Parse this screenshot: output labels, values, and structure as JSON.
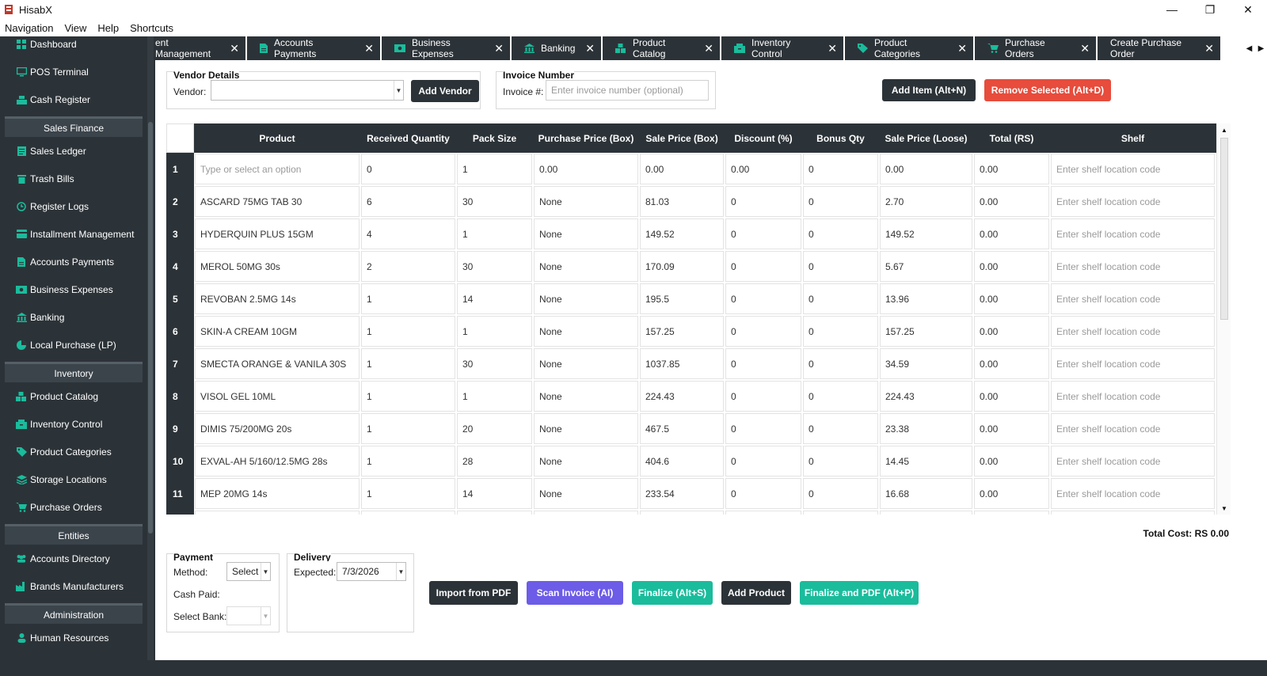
{
  "window": {
    "title": "HisabX",
    "controls": {
      "minimize": "—",
      "restore": "❐",
      "close": "✕"
    }
  },
  "menu": [
    "Navigation",
    "View",
    "Help",
    "Shortcuts"
  ],
  "sidebar": {
    "items_top": [
      {
        "label": "Dashboard",
        "icon": "dashboard-icon"
      },
      {
        "label": "POS Terminal",
        "icon": "monitor-icon"
      },
      {
        "label": "Cash Register",
        "icon": "register-icon"
      }
    ],
    "sections": [
      {
        "title": "Sales  Finance",
        "items": [
          {
            "label": "Sales Ledger",
            "icon": "ledger-icon"
          },
          {
            "label": "Trash Bills",
            "icon": "trash-icon"
          },
          {
            "label": "Register Logs",
            "icon": "history-icon"
          },
          {
            "label": "Installment Management",
            "icon": "card-icon"
          },
          {
            "label": "Accounts  Payments",
            "icon": "invoice-icon"
          },
          {
            "label": "Business Expenses",
            "icon": "money-icon"
          },
          {
            "label": "Banking",
            "icon": "bank-icon"
          },
          {
            "label": "Local Purchase (LP)",
            "icon": "pie-icon"
          }
        ]
      },
      {
        "title": "Inventory",
        "items": [
          {
            "label": "Product Catalog",
            "icon": "boxes-icon"
          },
          {
            "label": "Inventory Control",
            "icon": "inventory-icon"
          },
          {
            "label": "Product Categories",
            "icon": "tags-icon"
          },
          {
            "label": "Storage Locations",
            "icon": "layers-icon"
          },
          {
            "label": "Purchase Orders",
            "icon": "cart-icon"
          }
        ]
      },
      {
        "title": "Entities",
        "items": [
          {
            "label": "Accounts Directory",
            "icon": "users-icon"
          },
          {
            "label": "Brands  Manufacturers",
            "icon": "factory-icon"
          }
        ]
      },
      {
        "title": "Administration",
        "items": [
          {
            "label": "Human Resources",
            "icon": "user-icon"
          }
        ]
      }
    ]
  },
  "tabs": [
    {
      "label": "ent Management",
      "icon": "",
      "width": 114
    },
    {
      "label": "Accounts  Payments",
      "icon": "invoice-icon"
    },
    {
      "label": "Business Expenses",
      "icon": "money-icon"
    },
    {
      "label": "Banking",
      "icon": "bank-icon"
    },
    {
      "label": "Product Catalog",
      "icon": "boxes-icon"
    },
    {
      "label": "Inventory Control",
      "icon": "inventory-icon"
    },
    {
      "label": "Product Categories",
      "icon": "tags-icon"
    },
    {
      "label": "Purchase Orders",
      "icon": "cart-icon"
    },
    {
      "label": "Create Purchase Order",
      "icon": ""
    }
  ],
  "vendor": {
    "group_title": "Vendor Details",
    "label": "Vendor:",
    "value": "",
    "add_button": "Add Vendor"
  },
  "invoice": {
    "group_title": "Invoice Number",
    "label": "Invoice #:",
    "placeholder": "Enter invoice number (optional)"
  },
  "actions": {
    "add_item": "Add Item (Alt+N)",
    "remove_selected": "Remove Selected (Alt+D)"
  },
  "table": {
    "columns": [
      "Product",
      "Received Quantity",
      "Pack Size",
      "Purchase Price (Box)",
      "Sale Price (Box)",
      "Discount (%)",
      "Bonus Qty",
      "Sale Price (Loose)",
      "Total (RS)",
      "Shelf"
    ],
    "product_placeholder": "Type or select an option",
    "shelf_placeholder": "Enter shelf location code",
    "rows": [
      [
        "1",
        "",
        "0",
        "1",
        "0.00",
        "0.00",
        "0.00",
        "0",
        "0.00",
        "0.00",
        ""
      ],
      [
        "2",
        "ASCARD 75MG TAB 30",
        "6",
        "30",
        "None",
        "81.03",
        "0",
        "0",
        "2.70",
        "0.00",
        ""
      ],
      [
        "3",
        "HYDERQUIN PLUS 15GM",
        "4",
        "1",
        "None",
        "149.52",
        "0",
        "0",
        "149.52",
        "0.00",
        ""
      ],
      [
        "4",
        "MEROL 50MG 30s",
        "2",
        "30",
        "None",
        "170.09",
        "0",
        "0",
        "5.67",
        "0.00",
        ""
      ],
      [
        "5",
        "REVOBAN 2.5MG 14s",
        "1",
        "14",
        "None",
        "195.5",
        "0",
        "0",
        "13.96",
        "0.00",
        ""
      ],
      [
        "6",
        "SKIN-A CREAM 10GM",
        "1",
        "1",
        "None",
        "157.25",
        "0",
        "0",
        "157.25",
        "0.00",
        ""
      ],
      [
        "7",
        "SMECTA ORANGE & VANILA 30S",
        "1",
        "30",
        "None",
        "1037.85",
        "0",
        "0",
        "34.59",
        "0.00",
        ""
      ],
      [
        "8",
        "VISOL GEL 10ML",
        "1",
        "1",
        "None",
        "224.43",
        "0",
        "0",
        "224.43",
        "0.00",
        ""
      ],
      [
        "9",
        "DIMIS 75/200MG 20s",
        "1",
        "20",
        "None",
        "467.5",
        "0",
        "0",
        "23.38",
        "0.00",
        ""
      ],
      [
        "10",
        "EXVAL-AH 5/160/12.5MG 28s",
        "1",
        "28",
        "None",
        "404.6",
        "0",
        "0",
        "14.45",
        "0.00",
        ""
      ],
      [
        "11",
        "MEP 20MG 14s",
        "1",
        "14",
        "None",
        "233.54",
        "0",
        "0",
        "16.68",
        "0.00",
        ""
      ],
      [
        "",
        "",
        "",
        "",
        "",
        "",
        "",
        "",
        "",
        "",
        ""
      ]
    ]
  },
  "total_cost": "Total Cost: RS 0.00",
  "payment": {
    "group_title": "Payment",
    "method_label": "Method:",
    "method_value": "Select",
    "cash_paid_label": "Cash Paid:",
    "bank_label": "Select Bank:",
    "bank_value": ""
  },
  "delivery": {
    "group_title": "Delivery",
    "expected_label": "Expected:",
    "expected_value": "7/3/2026"
  },
  "bottom_buttons": {
    "import_pdf": "Import from PDF",
    "scan_invoice": "Scan Invoice (AI)",
    "finalize": "Finalize (Alt+S)",
    "add_product": "Add Product",
    "finalize_pdf": "Finalize and PDF (Alt+P)"
  },
  "colors": {
    "dark": "#2c3338",
    "teal": "#1abc9c",
    "red": "#e74c3c",
    "purple": "#6c5ce7"
  }
}
